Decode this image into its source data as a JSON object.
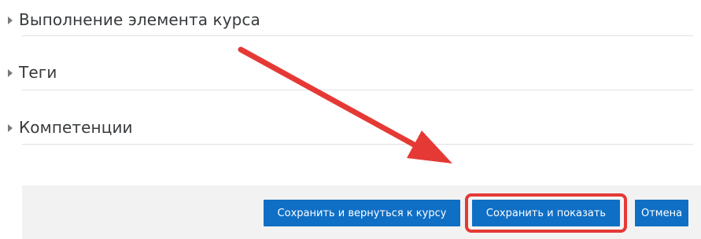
{
  "sections": [
    {
      "title": "Выполнение элемента курса"
    },
    {
      "title": "Теги"
    },
    {
      "title": "Компетенции"
    }
  ],
  "buttons": {
    "save_return": "Сохранить и вернуться к курсу",
    "save_display": "Сохранить и показать",
    "cancel": "Отмена"
  },
  "colors": {
    "button": "#0f6fc5",
    "highlight": "#e53935",
    "footer_bg": "#f2f2f2"
  },
  "annotation": {
    "arrow_icon": "red-arrow-icon",
    "highlight": "red-rounded-box"
  }
}
